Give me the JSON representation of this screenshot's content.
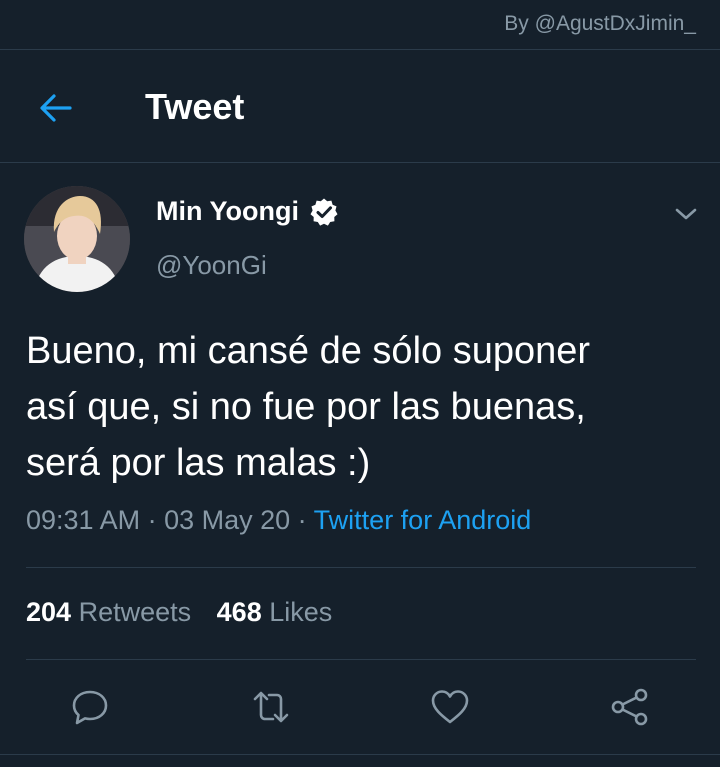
{
  "watermark": "By @AgustDxJimin_",
  "header": {
    "title": "Tweet",
    "back_icon": "arrow-left-icon"
  },
  "tweet": {
    "display_name": "Min Yoongi",
    "verified_icon": "verified-badge-icon",
    "handle": "@YoonGi",
    "text_lines": [
      "Bueno, mi cansé de sólo suponer",
      "así que, si no fue por las buenas,",
      "será por las malas :)"
    ],
    "time": "09:31 AM",
    "separator": " · ",
    "date": "03 May 20",
    "source": "Twitter for Android"
  },
  "stats": {
    "retweets_count": "204",
    "retweets_label": "Retweets",
    "likes_count": "468",
    "likes_label": "Likes"
  },
  "actions": [
    "reply-icon",
    "retweet-icon",
    "like-icon",
    "share-icon"
  ],
  "colors": {
    "background": "#15202b",
    "accent": "#1da1f2",
    "secondary_text": "#8899a6",
    "divider": "#2b3b4a"
  }
}
